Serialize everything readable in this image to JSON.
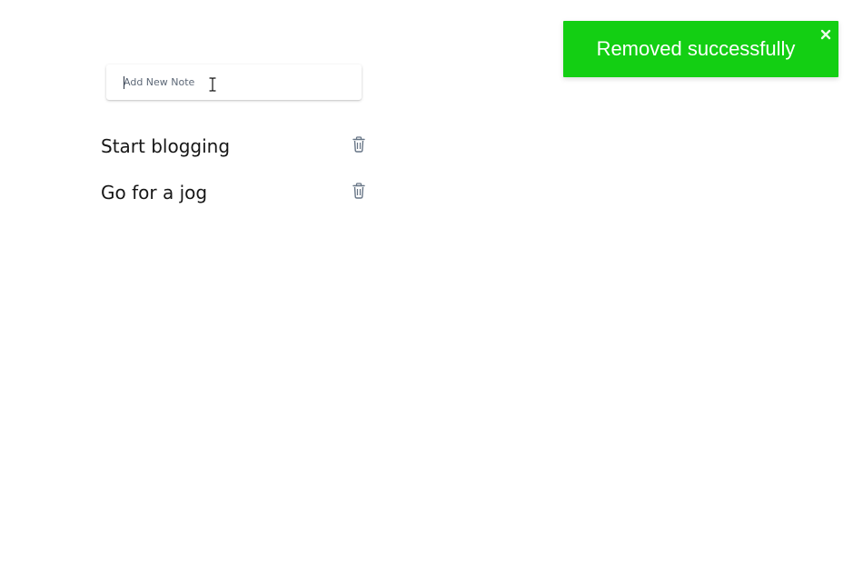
{
  "note_input": {
    "placeholder": "Add New Note",
    "value": ""
  },
  "notes": [
    {
      "text": "Start blogging"
    },
    {
      "text": "Go for a jog"
    }
  ],
  "toast": {
    "message": "Removed successfully",
    "background_color": "#13cf13"
  },
  "icons": {
    "delete": "trash-icon",
    "close": "close-icon",
    "text_cursor": "text-cursor-icon"
  }
}
